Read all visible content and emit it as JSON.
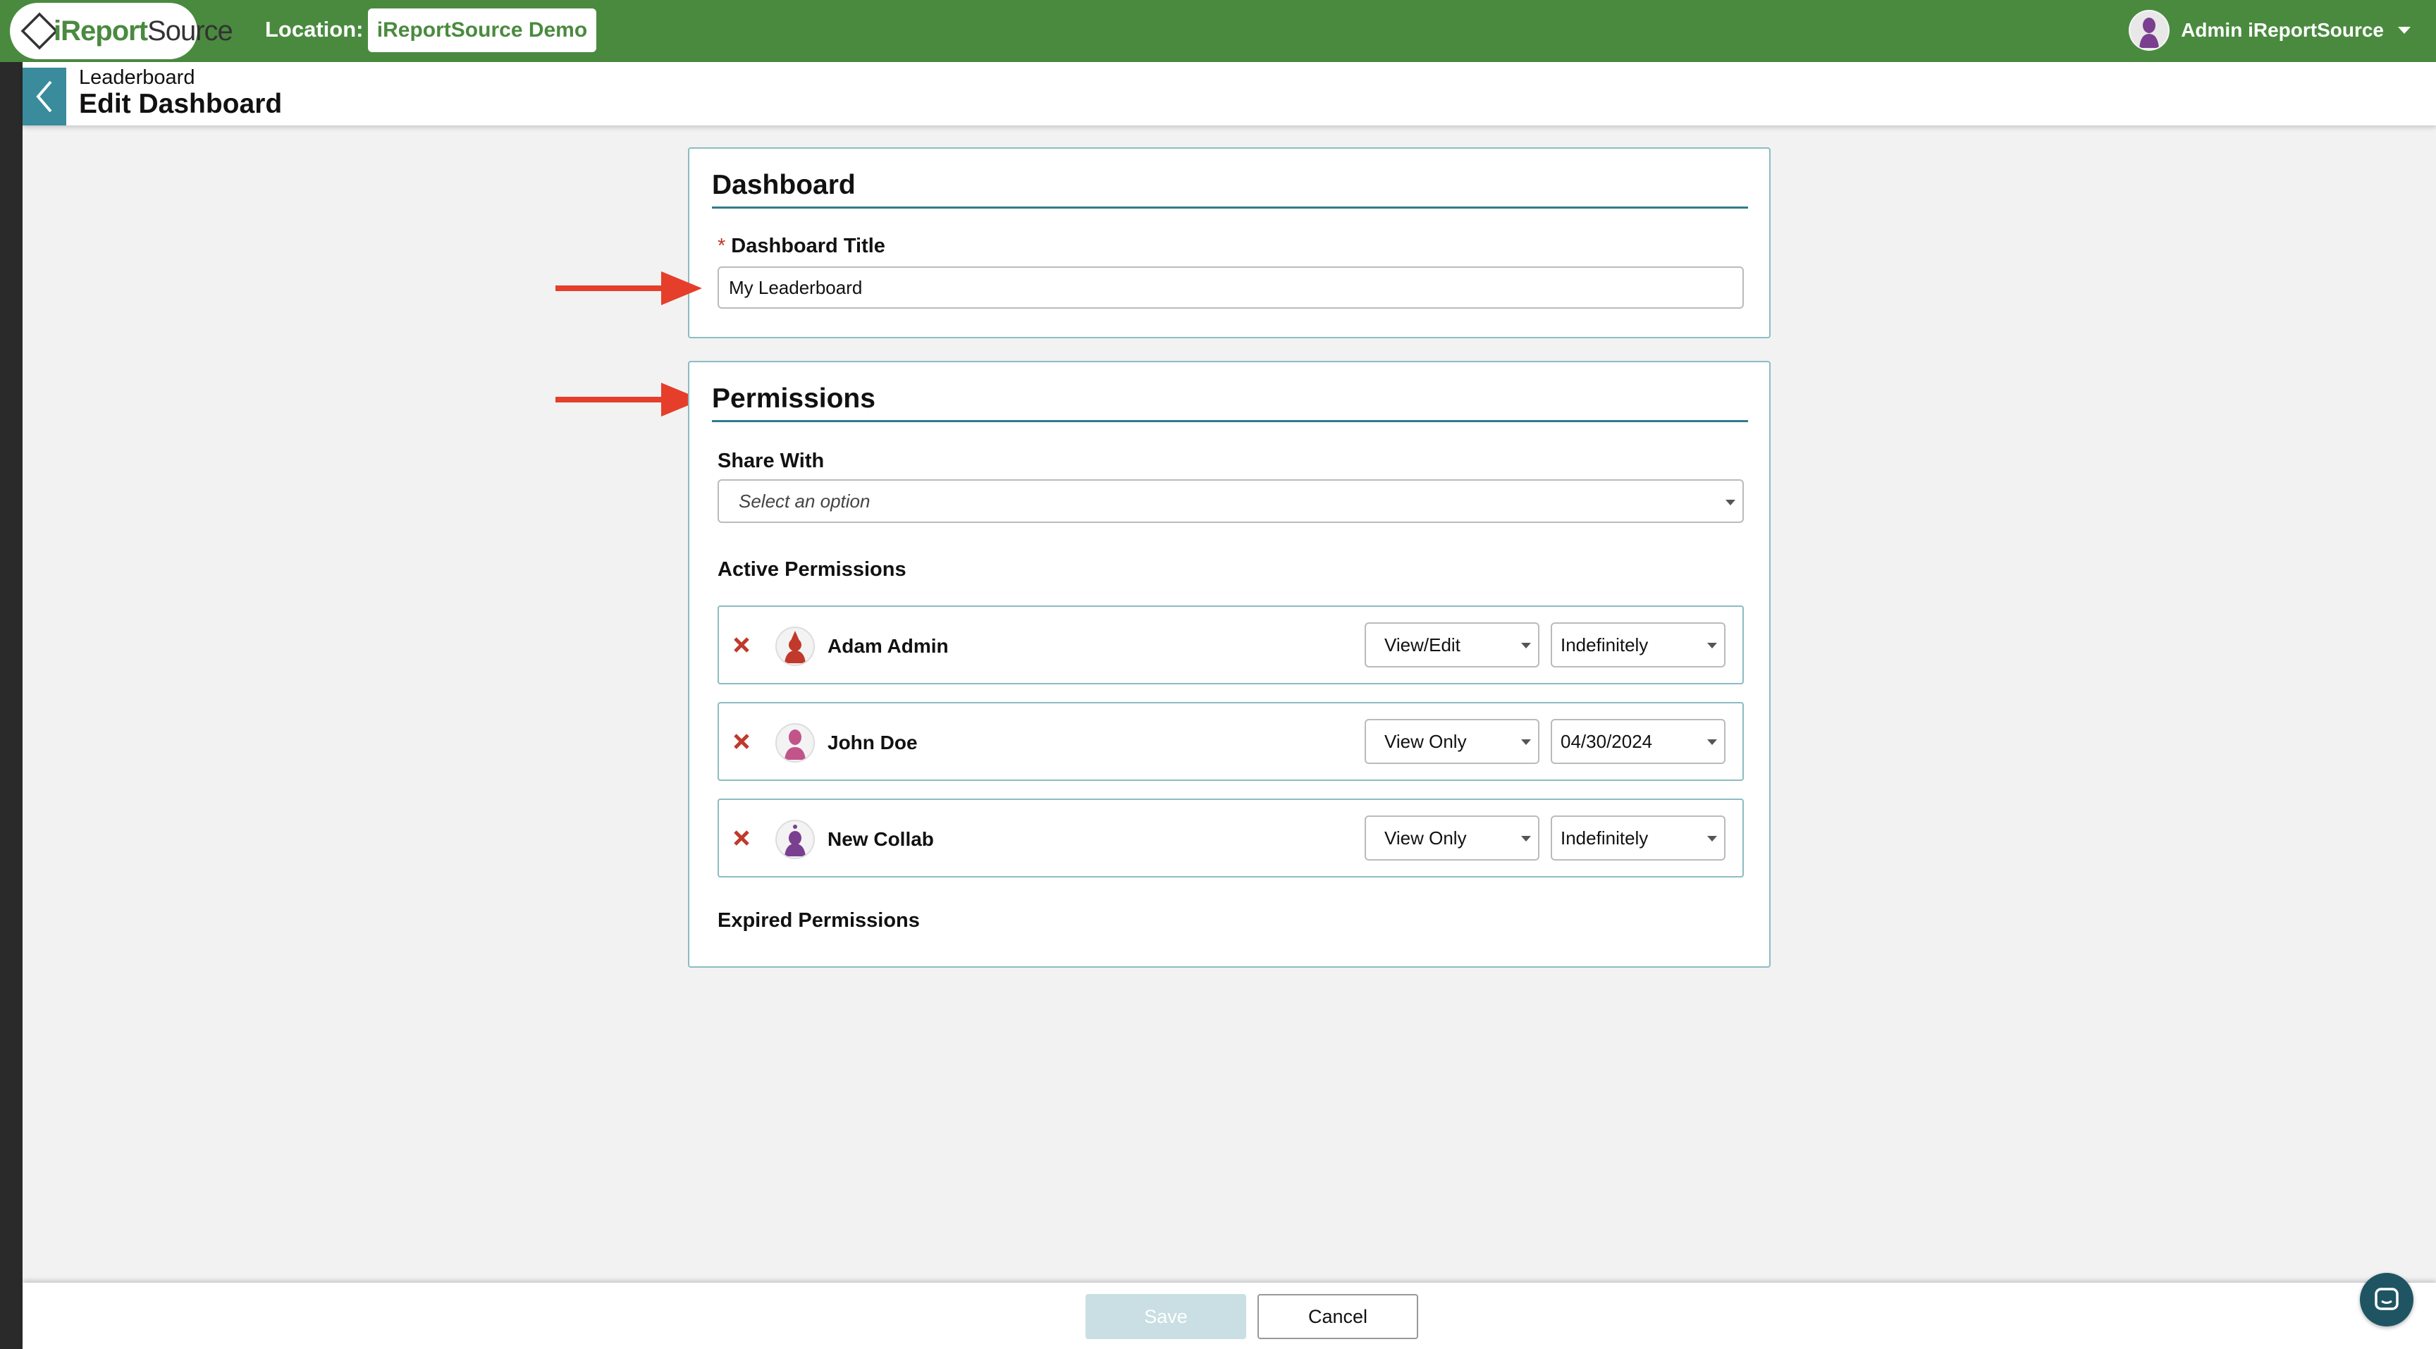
{
  "colors": {
    "brand_green": "#4a8a3f",
    "accent_teal": "#3a8c9c",
    "remove_red": "#c0392b",
    "annotation_red": "#e53e2a"
  },
  "header": {
    "logo_text_i": "i",
    "logo_text_report": "Report",
    "logo_text_source": "Source",
    "location_label": "Location:",
    "location_value": "iReportSource Demo",
    "user_name": "Admin iReportSource"
  },
  "subheader": {
    "breadcrumb": "Leaderboard",
    "title": "Edit Dashboard"
  },
  "dashboard_section": {
    "title": "Dashboard",
    "required_mark": "*",
    "title_label": "Dashboard Title",
    "title_value": "My Leaderboard"
  },
  "permissions_section": {
    "title": "Permissions",
    "share_with_label": "Share With",
    "share_with_placeholder": "Select an option",
    "active_label": "Active Permissions",
    "expired_label": "Expired Permissions",
    "active": [
      {
        "name": "Adam Admin",
        "role": "View/Edit",
        "expires": "Indefinitely",
        "avatar_color": "#c0392b"
      },
      {
        "name": "John Doe",
        "role": "View Only",
        "expires": "04/30/2024",
        "avatar_color": "#c2548a"
      },
      {
        "name": "New Collab",
        "role": "View Only",
        "expires": "Indefinitely",
        "avatar_color": "#7a3f8f"
      }
    ]
  },
  "footer": {
    "save_label": "Save",
    "cancel_label": "Cancel"
  },
  "icons": {
    "back": "chevron-left-icon",
    "remove": "close-icon",
    "chat": "chat-icon",
    "dropdown": "chevron-down-icon"
  }
}
